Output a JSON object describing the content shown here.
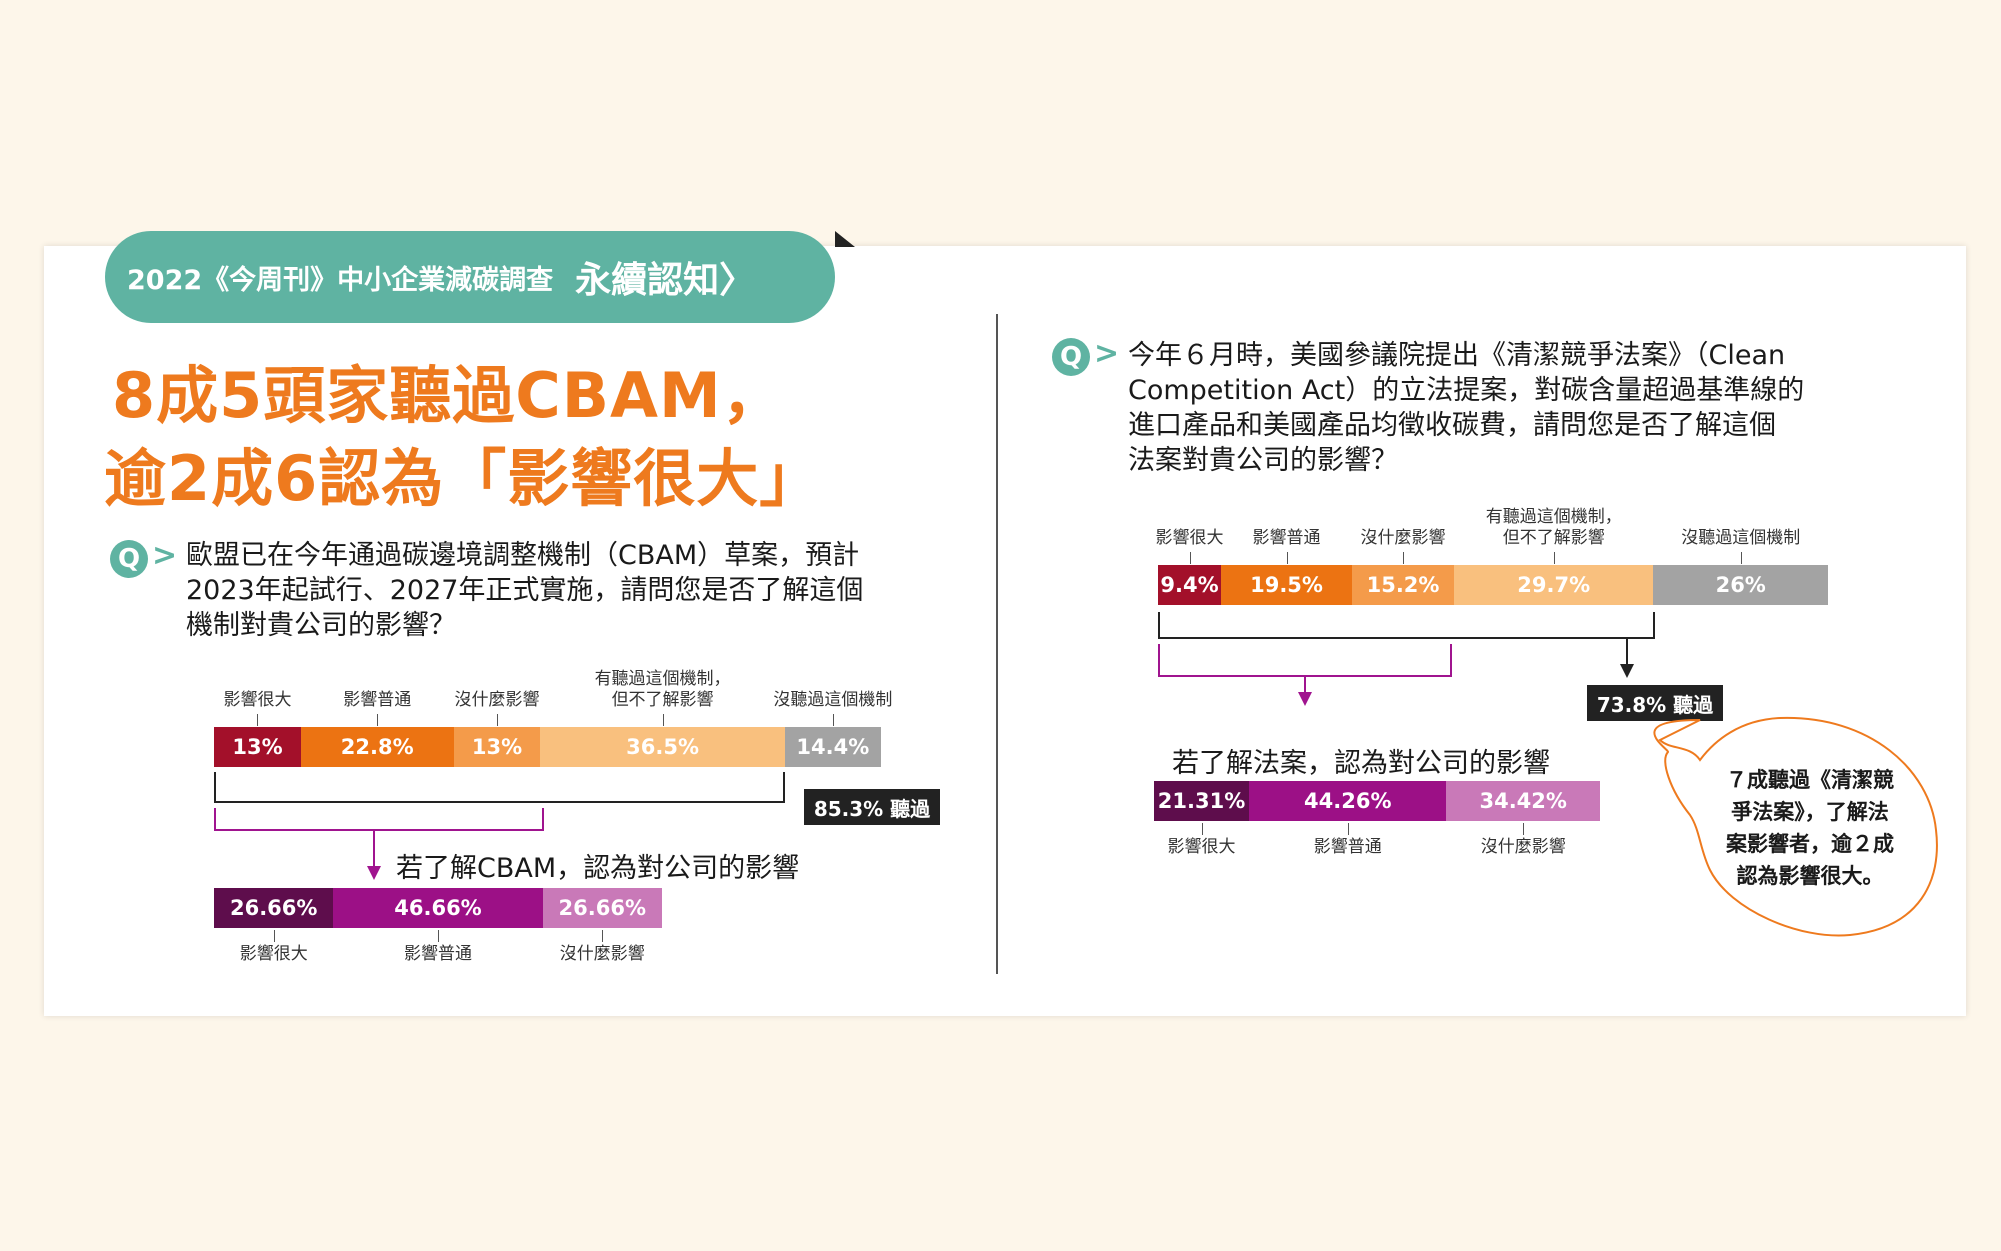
{
  "header": {
    "survey_title": "2022《今周刊》中小企業減碳調查",
    "section_title": "永續認知〉",
    "headline_line1": "8成5頭家聽過CBAM，",
    "headline_line2": "逾2成6認為「影響很大」"
  },
  "question_icon": "Q",
  "left": {
    "question_lines": [
      "歐盟已在今年通過碳邊境調整機制（CBAM）草案，預計",
      "2023年起試行、2027年正式實施，請問您是否了解這個",
      "機制對貴公司的影響？"
    ],
    "labels": [
      "影響很大",
      "影響普通",
      "沒什麼影響",
      "有聽過這個機制，\n但不了解影響",
      "沒聽過這個機制"
    ],
    "heard_badge": "85.3% 聽過",
    "sub_title": "若了解CBAM，認為對公司的影響",
    "sub_labels": [
      "影響很大",
      "影響普通",
      "沒什麼影響"
    ]
  },
  "right": {
    "question_lines": [
      "今年６月時，美國參議院提出《清潔競爭法案》（Clean",
      "Competition Act）的立法提案，對碳含量超過基準線的",
      "進口產品和美國產品均徵收碳費，請問您是否了解這個",
      "法案對貴公司的影響？"
    ],
    "labels": [
      "影響很大",
      "影響普通",
      "沒什麼影響",
      "有聽過這個機制，\n但不了解影響",
      "沒聽過這個機制"
    ],
    "heard_badge": "73.8% 聽過",
    "sub_title": "若了解法案，認為對公司的影響",
    "sub_labels": [
      "影響很大",
      "影響普通",
      "沒什麼影響"
    ],
    "bubble_lines": [
      "７成聽過《清潔競",
      "爭法案》，了解法",
      "案影響者，逾２成",
      "認為影響很大。"
    ]
  },
  "colors": {
    "teal": "#5fb3a2",
    "orange_headline": "#ee7a1e",
    "main_bar": [
      "#a3102a",
      "#ec7312",
      "#f49b4a",
      "#f9c07e",
      "#a3a3a3"
    ],
    "sub_bar": [
      "#5e0d4c",
      "#9c1086",
      "#c979b8"
    ],
    "purple_line": "#a0148f"
  },
  "chart_data": [
    {
      "type": "bar",
      "orientation": "stacked-horizontal",
      "categories": [
        "影響很大",
        "影響普通",
        "沒什麼影響",
        "有聽過這個機制，但不了解影響",
        "沒聽過這個機制"
      ],
      "values": [
        13,
        22.8,
        13,
        36.5,
        14.4
      ],
      "value_labels": [
        "13%",
        "22.8%",
        "13%",
        "36.5%",
        "14.4%"
      ]
    },
    {
      "type": "bar",
      "orientation": "stacked-horizontal",
      "categories": [
        "影響很大",
        "影響普通",
        "沒什麼影響"
      ],
      "values": [
        26.66,
        46.66,
        26.66
      ],
      "value_labels": [
        "26.66%",
        "46.66%",
        "26.66%"
      ]
    },
    {
      "type": "bar",
      "orientation": "stacked-horizontal",
      "categories": [
        "影響很大",
        "影響普通",
        "沒什麼影響",
        "有聽過這個機制，但不了解影響",
        "沒聽過這個機制"
      ],
      "values": [
        9.4,
        19.5,
        15.2,
        29.7,
        26
      ],
      "value_labels": [
        "9.4%",
        "19.5%",
        "15.2%",
        "29.7%",
        "26%"
      ]
    },
    {
      "type": "bar",
      "orientation": "stacked-horizontal",
      "categories": [
        "影響很大",
        "影響普通",
        "沒什麼影響"
      ],
      "values": [
        21.31,
        44.26,
        34.42
      ],
      "value_labels": [
        "21.31%",
        "44.26%",
        "34.42%"
      ]
    }
  ]
}
